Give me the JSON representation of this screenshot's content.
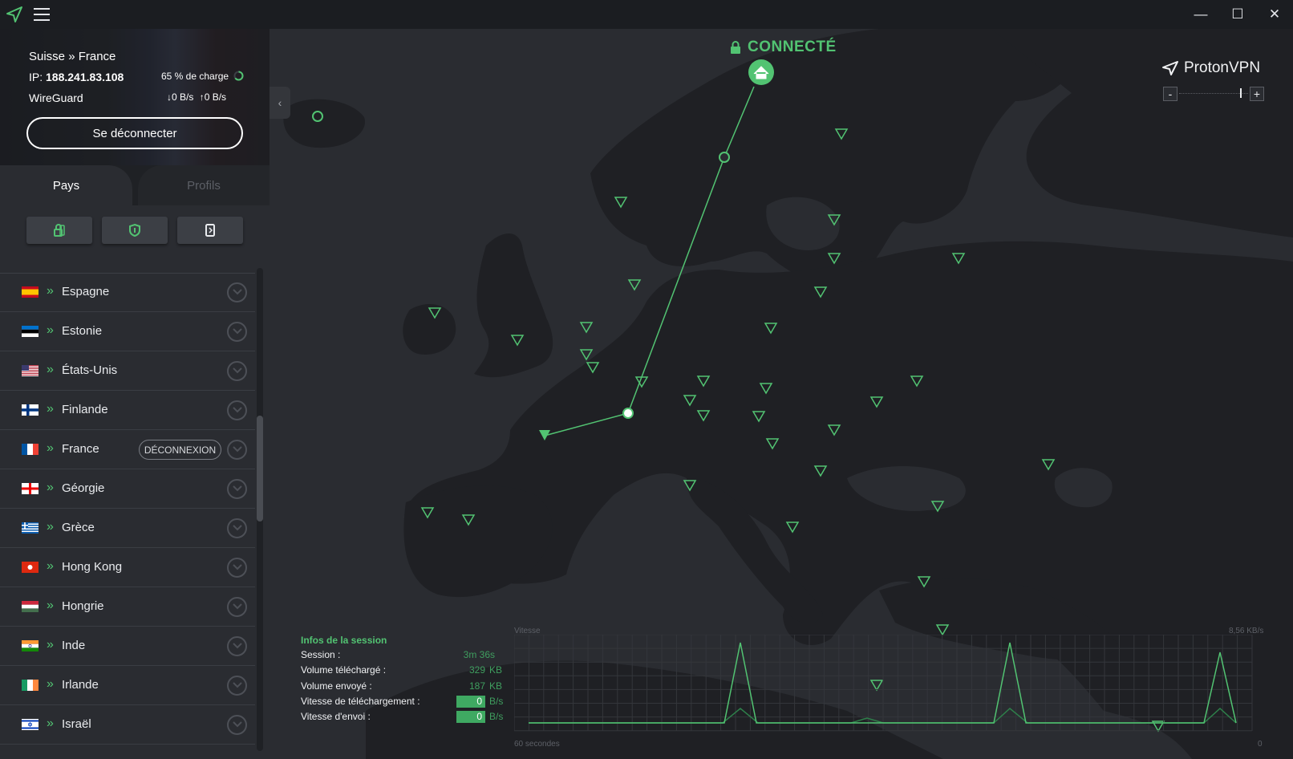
{
  "window": {
    "minimize_glyph": "—",
    "maximize_glyph": "☐",
    "close_glyph": "✕"
  },
  "connection": {
    "route": "Suisse » France",
    "ip_label": "IP:",
    "ip_value": "188.241.83.108",
    "load": "65 % de charge",
    "protocol": "WireGuard",
    "down_speed": "0 B/s",
    "up_speed": "0 B/s",
    "disconnect_label": "Se déconnecter"
  },
  "tabs": {
    "countries": "Pays",
    "profiles": "Profils"
  },
  "filters": [
    {
      "icon": "secure-core-icon"
    },
    {
      "icon": "shield-icon"
    },
    {
      "icon": "streaming-icon"
    }
  ],
  "countries": [
    {
      "name": "Espagne",
      "flag": "es"
    },
    {
      "name": "Estonie",
      "flag": "ee"
    },
    {
      "name": "États-Unis",
      "flag": "us"
    },
    {
      "name": "Finlande",
      "flag": "fi"
    },
    {
      "name": "France",
      "flag": "fr",
      "connected": true,
      "action": "DÉCONNEXION"
    },
    {
      "name": "Géorgie",
      "flag": "ge"
    },
    {
      "name": "Grèce",
      "flag": "gr"
    },
    {
      "name": "Hong Kong",
      "flag": "hk"
    },
    {
      "name": "Hongrie",
      "flag": "hu"
    },
    {
      "name": "Inde",
      "flag": "in"
    },
    {
      "name": "Irlande",
      "flag": "ie"
    },
    {
      "name": "Israël",
      "flag": "il"
    }
  ],
  "map": {
    "status": "CONNECTÉ",
    "brand": "ProtonVPN",
    "zoom_minus": "-",
    "zoom_plus": "+"
  },
  "session": {
    "title": "Infos de la session",
    "rows": [
      {
        "label": "Session :",
        "value": "3m 36s",
        "unit": ""
      },
      {
        "label": "Volume téléchargé :",
        "value": "329",
        "unit": "KB"
      },
      {
        "label": "Volume envoyé :",
        "value": "187",
        "unit": "KB"
      },
      {
        "label": "Vitesse de téléchargement :",
        "value": "0",
        "unit": "B/s",
        "boxed": true
      },
      {
        "label": "Vitesse d'envoi :",
        "value": "0",
        "unit": "B/s",
        "boxed": true
      }
    ]
  },
  "graph": {
    "speed_label": "Vitesse",
    "max_label": "8,56  KB/s",
    "time_label": "60 secondes",
    "zero_label": "0"
  },
  "colors": {
    "accent": "#52c372",
    "background": "#2a2c31",
    "land": "#1f2024"
  }
}
